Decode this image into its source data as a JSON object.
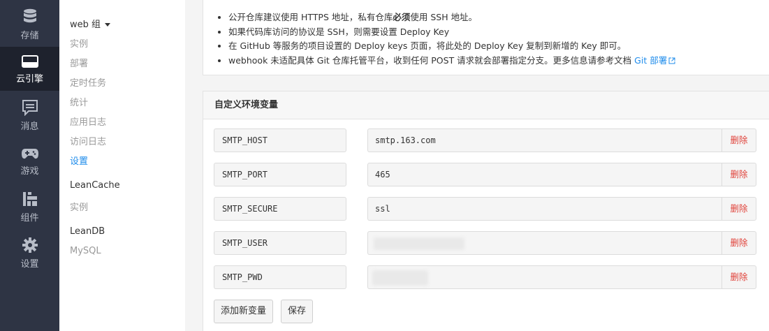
{
  "nav": {
    "items": [
      {
        "label": "存储",
        "icon": "database-icon"
      },
      {
        "label": "云引擎",
        "icon": "server-icon",
        "active": true
      },
      {
        "label": "消息",
        "icon": "message-icon"
      },
      {
        "label": "游戏",
        "icon": "gamepad-icon"
      },
      {
        "label": "组件",
        "icon": "components-icon"
      },
      {
        "label": "设置",
        "icon": "gear-icon"
      }
    ]
  },
  "submenu": {
    "group_web": "web 组",
    "web_items": [
      "实例",
      "部署",
      "定时任务",
      "统计",
      "应用日志",
      "访问日志",
      "设置"
    ],
    "group_leancache": "LeanCache",
    "leancache_items": [
      "实例"
    ],
    "group_leandb": "LeanDB",
    "leandb_items": [
      "MySQL"
    ]
  },
  "notes": {
    "line1_before": "公开仓库建议使用 HTTPS 地址，私有仓库",
    "line1_bold": "必须",
    "line1_after": "使用 SSH 地址。",
    "line2": "如果代码库访问的协议是 SSH，则需要设置 Deploy Key",
    "line3": "在 GitHub 等服务的项目设置的 Deploy keys 页面，将此处的 Deploy Key 复制到新增的 Key 即可。",
    "line4": "webhook 未适配具体 Git 仓库托管平台，收到任何 POST 请求就会部署指定分支。更多信息请参考文档",
    "line4_link": "Git 部署"
  },
  "env": {
    "title": "自定义环境变量",
    "rows": [
      {
        "key": "SMTP_HOST",
        "value": "smtp.163.com",
        "delete": "删除"
      },
      {
        "key": "SMTP_PORT",
        "value": "465",
        "delete": "删除"
      },
      {
        "key": "SMTP_SECURE",
        "value": "ssl",
        "delete": "删除"
      },
      {
        "key": "SMTP_USER",
        "value": "",
        "delete": "删除"
      },
      {
        "key": "SMTP_PWD",
        "value": "",
        "delete": "删除"
      }
    ],
    "add_button": "添加新变量",
    "save_button": "保存"
  },
  "colors": {
    "rail_bg": "#2e3444",
    "rail_active": "#1e222d",
    "link": "#1f8ceb",
    "danger": "#e0433b"
  }
}
